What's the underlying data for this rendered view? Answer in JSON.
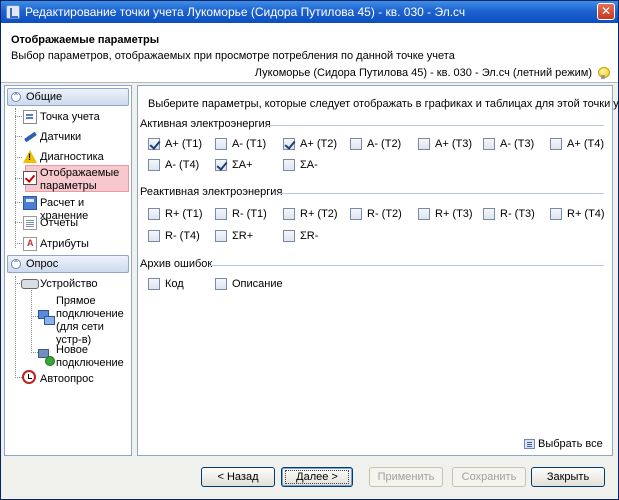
{
  "window": {
    "title": "Редактирование точки учета Лукоморье (Сидора Путилова 45) - кв. 030 - Эл.сч",
    "close_symbol": "✕"
  },
  "header": {
    "title": "Отображаемые параметры",
    "subtitle": "Выбор параметров, отображаемых при просмотре потребления по данной точке учета",
    "point_info": "Лукоморье (Сидора Путилова 45) - кв. 030 - Эл.сч (летний режим)"
  },
  "nav": {
    "group_general": "Общие",
    "group_survey": "Опрос",
    "toggle_symbol": "⌃",
    "items": [
      {
        "label": "Точка учета",
        "icon": "point-icon"
      },
      {
        "label": "Датчики",
        "icon": "pencil-icon"
      },
      {
        "label": "Диагностика",
        "icon": "warning-icon"
      },
      {
        "label": "Отображаемые параметры",
        "icon": "checkbox-icon"
      },
      {
        "label": "Расчет и хранение",
        "icon": "calculator-icon"
      },
      {
        "label": "Отчеты",
        "icon": "document-icon"
      },
      {
        "label": "Атрибуты",
        "icon": "attributes-icon"
      }
    ],
    "survey_items": [
      {
        "label": "Устройство",
        "icon": "device-icon"
      },
      {
        "label": "Прямое подключение (для сети устр-в)",
        "icon": "network-icon"
      },
      {
        "label": "Новое подключение",
        "icon": "new-connection-icon"
      },
      {
        "label": "Автоопрос",
        "icon": "clock-icon"
      }
    ]
  },
  "main": {
    "prompt": "Выберите параметры, которые следует отображать в графиках и таблицах для этой точки учета:",
    "sections": [
      {
        "title": "Активная электроэнергия",
        "items": [
          {
            "label": "A+ (T1)",
            "checked": true
          },
          {
            "label": "A- (T1)",
            "checked": false
          },
          {
            "label": "A+ (T2)",
            "checked": true
          },
          {
            "label": "A- (T2)",
            "checked": false
          },
          {
            "label": "A+ (T3)",
            "checked": false
          },
          {
            "label": "A- (T3)",
            "checked": false
          },
          {
            "label": "A+ (T4)",
            "checked": false
          },
          {
            "label": "A- (T4)",
            "checked": false
          },
          {
            "label": "ΣA+",
            "checked": true
          },
          {
            "label": "ΣA-",
            "checked": false
          }
        ]
      },
      {
        "title": "Реактивная электроэнергия",
        "items": [
          {
            "label": "R+ (T1)",
            "checked": false
          },
          {
            "label": "R- (T1)",
            "checked": false
          },
          {
            "label": "R+ (T2)",
            "checked": false
          },
          {
            "label": "R- (T2)",
            "checked": false
          },
          {
            "label": "R+ (T3)",
            "checked": false
          },
          {
            "label": "R- (T3)",
            "checked": false
          },
          {
            "label": "R+ (T4)",
            "checked": false
          },
          {
            "label": "R- (T4)",
            "checked": false
          },
          {
            "label": "ΣR+",
            "checked": false
          },
          {
            "label": "ΣR-",
            "checked": false
          }
        ]
      },
      {
        "title": "Архив ошибок",
        "items": [
          {
            "label": "Код",
            "checked": false
          },
          {
            "label": "Описание",
            "checked": false
          }
        ]
      }
    ],
    "select_all": "Выбрать все"
  },
  "footer": {
    "back": "< Назад",
    "next": "Далее >",
    "apply": "Применить",
    "save": "Сохранить",
    "close": "Закрыть"
  }
}
